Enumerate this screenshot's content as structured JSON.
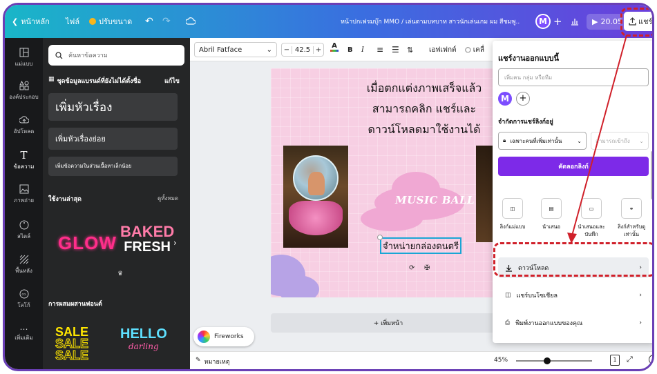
{
  "topbar": {
    "back_label": "หน้าหลัก",
    "file_label": "ไฟล์",
    "resize_label": "ปรับขนาด",
    "doc_title": "หน้าปกเฟรมบุ๊ก MMO / เล่นตามบทบาท สาวนักเล่นเกม ผม สีชมพู..",
    "avatar_initial": "M",
    "present_label": "20.05",
    "share_label": "แชร์"
  },
  "rail": {
    "items": [
      {
        "label": "แม่แบบ",
        "icon": "template-icon"
      },
      {
        "label": "องค์ประกอบ",
        "icon": "elements-icon"
      },
      {
        "label": "อัปโหลด",
        "icon": "upload-icon"
      },
      {
        "label": "ข้อความ",
        "icon": "text-icon"
      },
      {
        "label": "ภาพถ่าย",
        "icon": "photo-icon"
      },
      {
        "label": "สไตล์",
        "icon": "style-icon"
      },
      {
        "label": "พื้นหลัง",
        "icon": "background-icon"
      },
      {
        "label": "โลโก้",
        "icon": "logo-icon"
      },
      {
        "label": "เพิ่มเติม",
        "icon": "more-icon"
      }
    ]
  },
  "panel": {
    "search_placeholder": "ค้นหาข้อความ",
    "brand_kit_label": "ชุดข้อมูลแบรนด์ที่ยังไม่ได้ตั้งชื่อ",
    "edit_label": "แก้ไข",
    "add_heading": "เพิ่มหัวเรื่อง",
    "add_subheading": "เพิ่มหัวเรื่องย่อย",
    "add_body": "เพิ่มข้อความในส่วนเนื้อหาเล็กน้อย",
    "recent_label": "ใช้งานล่าสุด",
    "see_all": "ดูทั้งหมด",
    "sample1": "GLOW",
    "sample2a": "BAKED",
    "sample2b": "FRESH",
    "combo_label": "การผสมผสานฟอนต์",
    "sample3": "SALE",
    "sample4a": "HELLO",
    "sample4b": "darling"
  },
  "toolbar": {
    "font": "Abril Fatface",
    "size": "42.5",
    "effects": "เอฟเฟกต์",
    "more": "เคลื่"
  },
  "canvas": {
    "headline1": "เมื่อตกแต่งภาพเสร็จแล้ว",
    "headline2": "สามารถคลิก แชร์และ",
    "headline3": "ดาวน์โหลดมาใช้งานได้",
    "music_ball": "MUSIC BALL",
    "selected_text": "จำหน่ายกล่องดนตรี",
    "add_page": "+ เพิ่มหน้า",
    "fireworks": "Fireworks"
  },
  "bottombar": {
    "notes": "หมายเหตุ",
    "zoom": "45%",
    "zoom_fraction": 0.45,
    "page": "1"
  },
  "share": {
    "title": "แชร์งานออกแบบนี้",
    "input_placeholder": "เพิ่มคน กลุ่ม หรือทีม",
    "avatar_initial": "M",
    "access_label": "จำกัดการแชร์ลิงก์อยู่",
    "access_option": "เฉพาะคนที่เพิ่มเท่านั้น",
    "permission_option": "สามารถเข้าถึง",
    "copy_link": "คัดลอกลิงก์",
    "opts": [
      {
        "label": "ลิงก์แม่แบบ"
      },
      {
        "label": "นำเสนอ"
      },
      {
        "label": "นำเสนอและบันทึก"
      },
      {
        "label": "ลิงก์สำหรับดูเท่านั้น"
      }
    ],
    "download": "ดาวน์โหลด",
    "share_social": "แชร์บนโซเชียล",
    "print": "พิมพ์งานออกแบบของคุณ"
  },
  "colors": {
    "accent_purple": "#7d2ae8",
    "annotation_red": "#d0202a"
  }
}
